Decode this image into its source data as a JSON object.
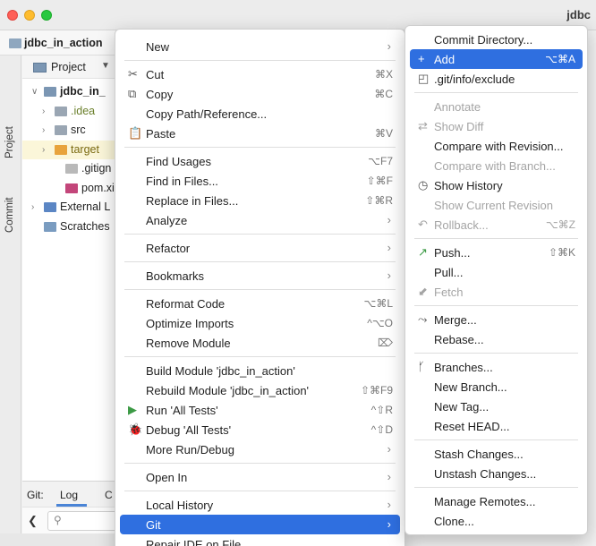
{
  "window": {
    "title": "jdbc"
  },
  "navbar": {
    "project_name": "jdbc_in_action"
  },
  "stripe": {
    "project": "Project",
    "commit": "Commit"
  },
  "project_panel": {
    "label": "Project",
    "caret": "▼"
  },
  "tree": [
    {
      "twisty": "∨",
      "icon": "module-folder-icon",
      "label": "jdbc_in_",
      "color": "#1f1f1f",
      "bold": true
    },
    {
      "twisty": "›",
      "icon": "folder-icon",
      "label": ".idea",
      "color": "#6a7f2a"
    },
    {
      "twisty": "›",
      "icon": "folder-icon",
      "label": "src",
      "color": "#1f1f1f"
    },
    {
      "twisty": "›",
      "icon": "excluded-folder-icon",
      "label": "target",
      "color": "#7a6a10"
    },
    {
      "twisty": "",
      "icon": "gitignore-file-icon",
      "label": ".gitign",
      "color": "#1f1f1f"
    },
    {
      "twisty": "",
      "icon": "maven-file-icon",
      "label": "pom.xi",
      "color": "#1f1f1f"
    },
    {
      "twisty": "›",
      "icon": "libraries-icon",
      "label": "External L",
      "color": "#1f1f1f"
    },
    {
      "twisty": "",
      "icon": "scratches-icon",
      "label": "Scratches",
      "color": "#1f1f1f"
    }
  ],
  "git_panel": {
    "label": "Git:",
    "tab_log": "Log",
    "tab_console": "C"
  },
  "context_menu": [
    {
      "label": "New",
      "arrow": true
    },
    {
      "sep": true
    },
    {
      "label": "Cut",
      "icon": "✂",
      "shortcut": "⌘X"
    },
    {
      "label": "Copy",
      "icon": "⧉",
      "shortcut": "⌘C"
    },
    {
      "label": "Copy Path/Reference..."
    },
    {
      "label": "Paste",
      "icon": "📋",
      "shortcut": "⌘V"
    },
    {
      "sep": true
    },
    {
      "label": "Find Usages",
      "shortcut": "⌥F7"
    },
    {
      "label": "Find in Files...",
      "shortcut": "⇧⌘F"
    },
    {
      "label": "Replace in Files...",
      "shortcut": "⇧⌘R"
    },
    {
      "label": "Analyze",
      "arrow": true
    },
    {
      "sep": true
    },
    {
      "label": "Refactor",
      "arrow": true
    },
    {
      "sep": true
    },
    {
      "label": "Bookmarks",
      "arrow": true
    },
    {
      "sep": true
    },
    {
      "label": "Reformat Code",
      "shortcut": "⌥⌘L"
    },
    {
      "label": "Optimize Imports",
      "shortcut": "^⌥O"
    },
    {
      "label": "Remove Module",
      "shortcut": "⌦"
    },
    {
      "sep": true
    },
    {
      "label": "Build Module 'jdbc_in_action'"
    },
    {
      "label": "Rebuild Module 'jdbc_in_action'",
      "shortcut": "⇧⌘F9"
    },
    {
      "label": "Run 'All Tests'",
      "icon": "▶",
      "shortcut": "^⇧R"
    },
    {
      "label": "Debug 'All Tests'",
      "icon": "🐞",
      "shortcut": "^⇧D"
    },
    {
      "label": "More Run/Debug",
      "arrow": true
    },
    {
      "sep": true
    },
    {
      "label": "Open In",
      "arrow": true
    },
    {
      "sep": true
    },
    {
      "label": "Local History",
      "arrow": true
    },
    {
      "label": "Git",
      "arrow": true,
      "selected": true
    },
    {
      "label": "Repair IDE on File"
    }
  ],
  "git_submenu": [
    {
      "label": "Commit Directory..."
    },
    {
      "label": "Add",
      "icon": "+",
      "shortcut": "⌥⌘A",
      "selected": true
    },
    {
      "label": ".git/info/exclude",
      "icon": "◰"
    },
    {
      "sep": true
    },
    {
      "label": "Annotate",
      "disabled": true
    },
    {
      "label": "Show Diff",
      "icon": "⇄",
      "disabled": true
    },
    {
      "label": "Compare with Revision..."
    },
    {
      "label": "Compare with Branch...",
      "disabled": true
    },
    {
      "label": "Show History",
      "icon": "◷"
    },
    {
      "label": "Show Current Revision",
      "disabled": true
    },
    {
      "label": "Rollback...",
      "icon": "↶",
      "shortcut": "⌥⌘Z",
      "disabled": true
    },
    {
      "sep": true
    },
    {
      "label": "Push...",
      "icon": "↗",
      "shortcut": "⇧⌘K"
    },
    {
      "label": "Pull..."
    },
    {
      "label": "Fetch",
      "icon": "⬋",
      "disabled": true
    },
    {
      "sep": true
    },
    {
      "label": "Merge...",
      "icon": "⤳"
    },
    {
      "label": "Rebase..."
    },
    {
      "sep": true
    },
    {
      "label": "Branches...",
      "icon": "ᚶ"
    },
    {
      "label": "New Branch..."
    },
    {
      "label": "New Tag..."
    },
    {
      "label": "Reset HEAD..."
    },
    {
      "sep": true
    },
    {
      "label": "Stash Changes..."
    },
    {
      "label": "Unstash Changes..."
    },
    {
      "sep": true
    },
    {
      "label": "Manage Remotes..."
    },
    {
      "label": "Clone..."
    }
  ],
  "colors": {
    "accent": "#2f6fe0",
    "run": "#3c9a45",
    "debug": "#4d8f2f",
    "push": "#3c9a45"
  }
}
